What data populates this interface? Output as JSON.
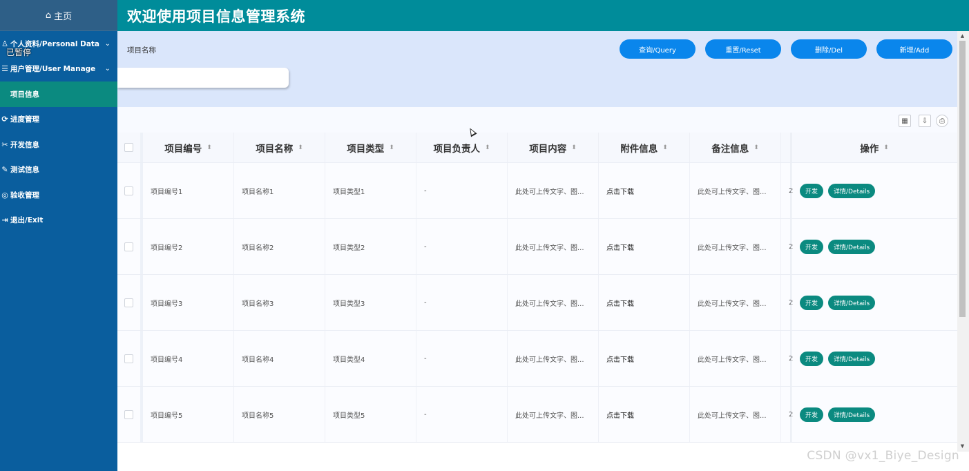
{
  "sidebar": {
    "home_label": "主页",
    "overlay_text": "已暂停",
    "items": [
      {
        "label": "个人资料/Personal Data",
        "icon": "user-icon",
        "chevron": "⌄"
      },
      {
        "label": "用户管理/User Manage",
        "icon": "users-icon",
        "chevron": "⌄"
      },
      {
        "label": "项目信息",
        "icon": ""
      },
      {
        "label": "进度管理",
        "icon": "progress-icon"
      },
      {
        "label": "开发信息",
        "icon": "tools-icon"
      },
      {
        "label": "测试信息",
        "icon": "test-icon"
      },
      {
        "label": "验收管理",
        "icon": "check-icon"
      },
      {
        "label": "退出/Exit",
        "icon": "exit-icon"
      }
    ]
  },
  "header": {
    "title": "欢迎使用项目信息管理系统"
  },
  "search": {
    "label": "项目名称",
    "value": "",
    "buttons": {
      "query": "查询/Query",
      "reset": "重置/Reset",
      "delete": "删除/Del",
      "add": "新增/Add"
    }
  },
  "table": {
    "columns": [
      "项目编号",
      "项目名称",
      "项目类型",
      "项目负责人",
      "项目内容",
      "附件信息",
      "备注信息",
      "操作"
    ],
    "rows": [
      {
        "no": "项目编号1",
        "name": "项目名称1",
        "type": "项目类型1",
        "owner": "-",
        "content": "此处可上传文字、图...",
        "attachment": "点击下载",
        "remark": "此处可上传文字、图...",
        "extra": "2"
      },
      {
        "no": "项目编号2",
        "name": "项目名称2",
        "type": "项目类型2",
        "owner": "-",
        "content": "此处可上传文字、图...",
        "attachment": "点击下载",
        "remark": "此处可上传文字、图...",
        "extra": "2"
      },
      {
        "no": "项目编号3",
        "name": "项目名称3",
        "type": "项目类型3",
        "owner": "-",
        "content": "此处可上传文字、图...",
        "attachment": "点击下载",
        "remark": "此处可上传文字、图...",
        "extra": "2"
      },
      {
        "no": "项目编号4",
        "name": "项目名称4",
        "type": "项目类型4",
        "owner": "-",
        "content": "此处可上传文字、图...",
        "attachment": "点击下载",
        "remark": "此处可上传文字、图...",
        "extra": "2"
      },
      {
        "no": "项目编号5",
        "name": "项目名称5",
        "type": "项目类型5",
        "owner": "-",
        "content": "此处可上传文字、图...",
        "attachment": "点击下载",
        "remark": "此处可上传文字、图...",
        "extra": "2"
      }
    ],
    "actions": {
      "develop": "开发",
      "details": "详情/Details"
    }
  },
  "watermark": "CSDN @vx1_Biye_Design",
  "colors": {
    "sidebar": "#0a5e9e",
    "header": "#008c9a",
    "active": "#0b8a80",
    "button": "#0a86ec",
    "search_bg": "#dae6fb"
  }
}
